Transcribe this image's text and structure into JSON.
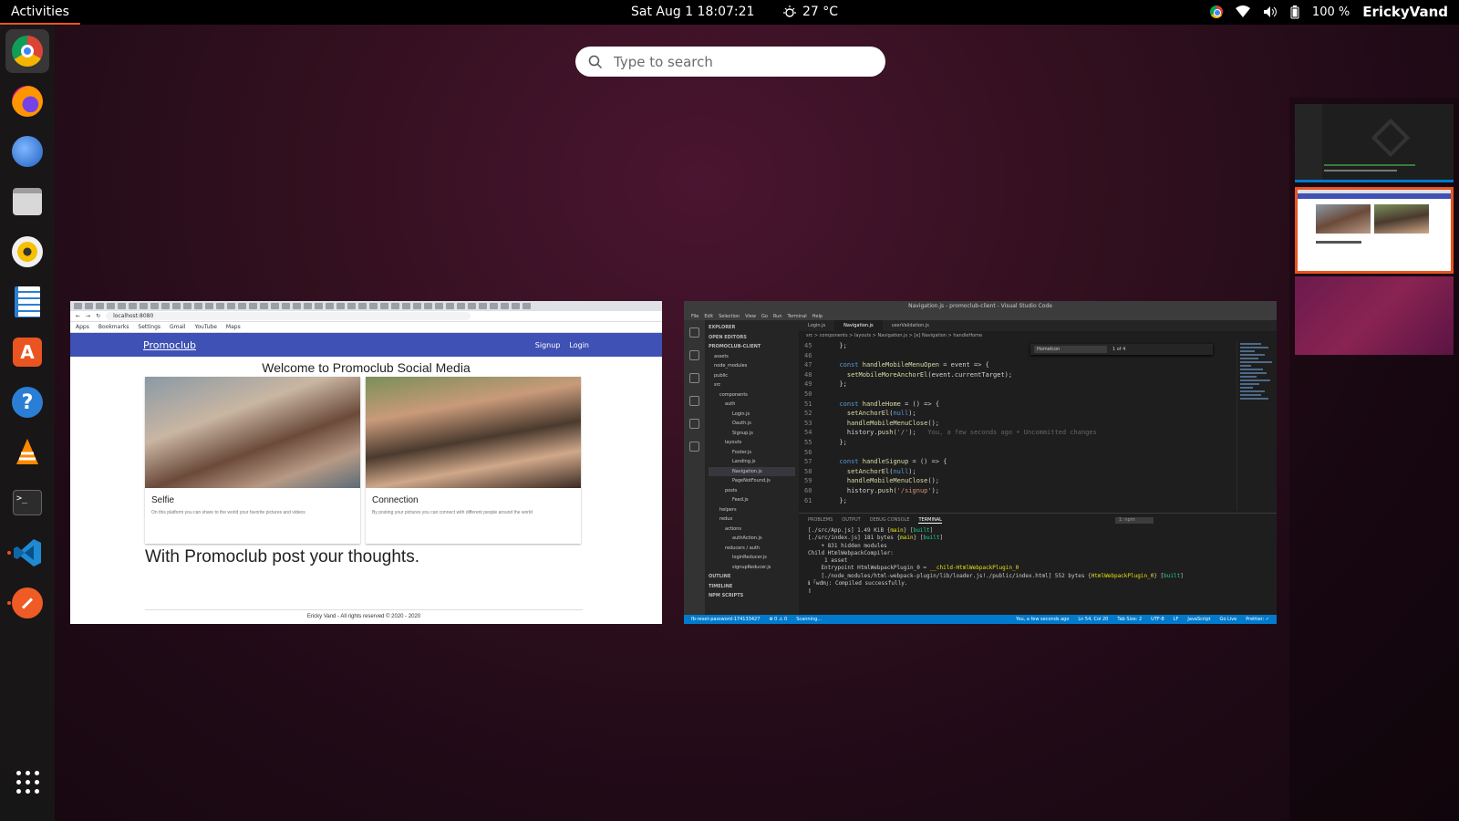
{
  "topbar": {
    "activities": "Activities",
    "clock": "Sat Aug 1  18:07:21",
    "weather": "27 °C",
    "battery": "100 %",
    "user": "ErickyVand"
  },
  "search": {
    "placeholder": "Type to search"
  },
  "dock": {
    "items": [
      "chrome",
      "firefox",
      "thunderbird",
      "files",
      "rhythmbox",
      "libreoffice-writer",
      "ubuntu-software",
      "help",
      "vlc",
      "terminal",
      "vscode",
      "postman",
      "show-applications"
    ]
  },
  "browser": {
    "url": "localhost:8080",
    "bookmarks": [
      "Apps",
      "Bookmarks",
      "Settings",
      "Gmail",
      "YouTube",
      "Maps"
    ],
    "brand": "Promoclub",
    "nav_signup": "Signup",
    "nav_login": "Login",
    "heading": "Welcome to Promoclub Social Media",
    "cards": [
      {
        "title": "Selfie",
        "desc": "On this platform you can share to the world your favorite pictures and videos"
      },
      {
        "title": "Connection",
        "desc": "By posting your pictures you can connect with different people around the world"
      }
    ],
    "thoughts": "With Promoclub post your thoughts.",
    "footer": "Ericky Vand - All rights reserved © 2020 - 2020"
  },
  "vscode": {
    "title": "Navigation.js - promoclub-client - Visual Studio Code",
    "menu": [
      "File",
      "Edit",
      "Selection",
      "View",
      "Go",
      "Run",
      "Terminal",
      "Help"
    ],
    "tabs": [
      "Login.js",
      "Navigation.js",
      "userValidation.js"
    ],
    "breadcrumb": "src > components > layouts > Navigation.js > [e] Navigation > handleHome",
    "find_text": "HomeIcon",
    "find_count": "1 of 4",
    "explorer_title": "EXPLORER",
    "tree": [
      "OPEN EDITORS",
      "PROMOCLUB-CLIENT",
      "assets",
      "node_modules",
      "public",
      "src",
      "components",
      "auth",
      "Login.js",
      "Oauth.js",
      "Signup.js",
      "layouts",
      "Footer.js",
      "Landing.js",
      "Navigation.js",
      "PageNotFound.js",
      "posts",
      "Feed.js",
      "helpers",
      "redux",
      "actions",
      "authAction.js",
      "reducers / auth",
      "loginReducer.js",
      "signupReducer.js",
      "OUTLINE",
      "TIMELINE",
      "NPM SCRIPTS"
    ],
    "panel_tabs": [
      "PROBLEMS",
      "OUTPUT",
      "DEBUG CONSOLE",
      "TERMINAL"
    ],
    "terminal_select": "1: npm",
    "status_branch": "fb-reset-password-174133427",
    "status_errors": "⊗ 0 ⚠ 0",
    "status_scan": "Scanning...",
    "status_blame": "You, a few seconds ago",
    "status_pos": "Ln 54, Col 20",
    "status_tab": "Tab Size: 2",
    "status_enc": "UTF-8",
    "status_eol": "LF",
    "status_lang": "JavaScript",
    "status_live": "Go Live",
    "status_prettier": "Prettier: ✓"
  }
}
